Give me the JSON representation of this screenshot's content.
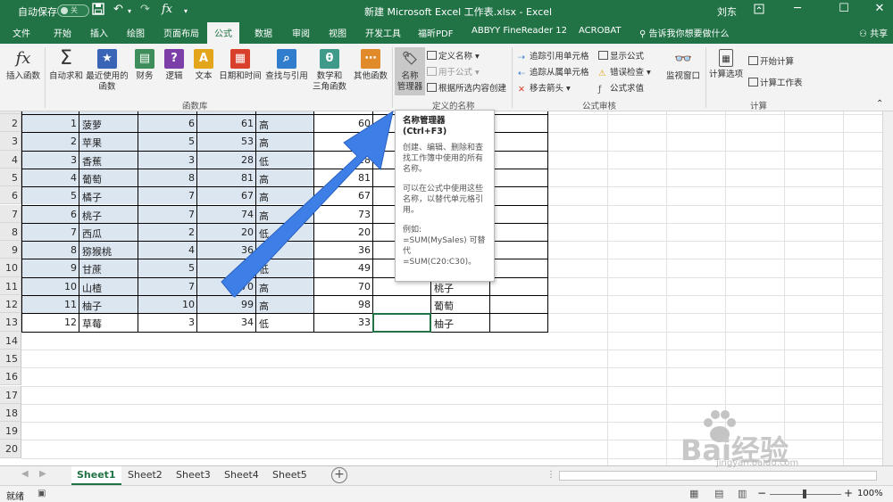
{
  "window": {
    "autosave_label": "自动保存",
    "autosave_state": "关",
    "title": "新建 Microsoft Excel 工作表.xlsx - Excel",
    "user": "刘东",
    "formula_symbol": "fx"
  },
  "tabs": [
    "文件",
    "开始",
    "插入",
    "绘图",
    "页面布局",
    "公式",
    "数据",
    "审阅",
    "视图",
    "开发工具",
    "福昕PDF",
    "ABBYY FineReader 12",
    "ACROBAT"
  ],
  "tell_me": "告诉我你想要做什么",
  "share": "共享",
  "ribbon": {
    "insert_function": "插入函数",
    "autosum": "自动求和",
    "recent": "最近使用的",
    "recent2": "函数",
    "finance": "财务",
    "logic": "逻辑",
    "text": "文本",
    "datetime": "日期和时间",
    "lookup": "查找与引用",
    "math": "数学和",
    "math2": "三角函数",
    "other": "其他函数",
    "name_manager": "名称",
    "name_manager2": "管理器",
    "define_name": "定义名称",
    "use_in_formula": "用于公式",
    "create_from_selection": "根据所选内容创建",
    "trace_precedents": "追踪引用单元格",
    "trace_dependents": "追踪从属单元格",
    "remove_arrows": "移去箭头",
    "show_formulas": "显示公式",
    "error_checking": "错误检查",
    "evaluate_formula": "公式求值",
    "watch_window": "监视窗口",
    "calc_options": "计算选项",
    "calc_now": "开始计算",
    "calc_sheet": "计算工作表",
    "group_library": "函数库",
    "group_names": "定义的名称",
    "group_audit": "公式审核",
    "group_calc": "计算"
  },
  "rows": [
    {
      "n": "2",
      "i": "1",
      "fruit": "菠萝",
      "c": "6",
      "d": "61",
      "e": "高",
      "f": "60",
      "h": ""
    },
    {
      "n": "3",
      "i": "2",
      "fruit": "苹果",
      "c": "5",
      "d": "53",
      "e": "高",
      "f": "52",
      "h": ""
    },
    {
      "n": "4",
      "i": "3",
      "fruit": "香蕉",
      "c": "3",
      "d": "28",
      "e": "低",
      "f": "28",
      "h": ""
    },
    {
      "n": "5",
      "i": "4",
      "fruit": "葡萄",
      "c": "8",
      "d": "81",
      "e": "高",
      "f": "81",
      "h": ""
    },
    {
      "n": "6",
      "i": "5",
      "fruit": "橘子",
      "c": "7",
      "d": "67",
      "e": "高",
      "f": "67",
      "h": ""
    },
    {
      "n": "7",
      "i": "6",
      "fruit": "桃子",
      "c": "7",
      "d": "74",
      "e": "高",
      "f": "73",
      "h": ""
    },
    {
      "n": "8",
      "i": "7",
      "fruit": "西瓜",
      "c": "2",
      "d": "20",
      "e": "低",
      "f": "20",
      "h": ""
    },
    {
      "n": "9",
      "i": "8",
      "fruit": "猕猴桃",
      "c": "4",
      "d": "36",
      "e": "低",
      "f": "36",
      "h": ""
    },
    {
      "n": "10",
      "i": "9",
      "fruit": "甘蔗",
      "c": "5",
      "d": "50",
      "e": "低",
      "f": "49",
      "h": ""
    },
    {
      "n": "11",
      "i": "10",
      "fruit": "山楂",
      "c": "7",
      "d": "70",
      "e": "高",
      "f": "70",
      "h": "桃子"
    },
    {
      "n": "12",
      "i": "11",
      "fruit": "柚子",
      "c": "10",
      "d": "99",
      "e": "高",
      "f": "98",
      "h": "葡萄"
    },
    {
      "n": "13",
      "i": "12",
      "fruit": "草莓",
      "c": "3",
      "d": "34",
      "e": "低",
      "f": "33",
      "h": "柚子"
    }
  ],
  "empty_rows": [
    "14",
    "15",
    "16",
    "17",
    "18",
    "19",
    "20"
  ],
  "tooltip": {
    "title": "名称管理器 (Ctrl+F3)",
    "p1": "创建、编辑、删除和查找工作簿中使用的所有名称。",
    "p2": "可以在公式中使用这些名称，以替代单元格引用。",
    "p3a": "例如:",
    "p3b": "=SUM(MySales) 可替代",
    "p3c": "=SUM(C20:C30)。"
  },
  "sheets": [
    "Sheet1",
    "Sheet2",
    "Sheet3",
    "Sheet4",
    "Sheet5"
  ],
  "status": {
    "ready": "就绪",
    "zoom": "100%"
  },
  "watermark": {
    "brand": "Bai经验",
    "url": "jingyan.baidu.com"
  },
  "colors": {
    "excel_green": "#217346",
    "arrow": "#3d7fe6",
    "row_band": "#dce6f1"
  }
}
